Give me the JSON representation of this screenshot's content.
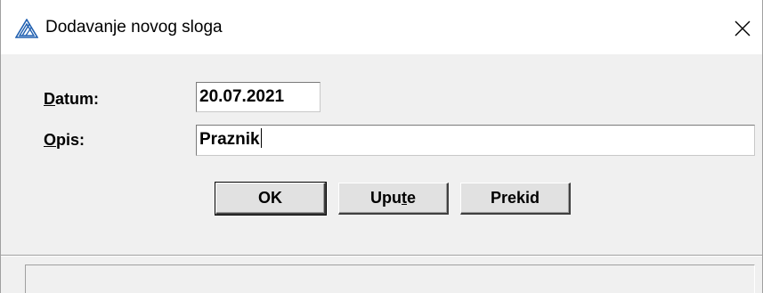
{
  "window": {
    "title": "Dodavanje novog sloga"
  },
  "form": {
    "datum_label_accel": "D",
    "datum_label_rest": "atum:",
    "datum_value": "20.07.2021",
    "opis_label_accel": "O",
    "opis_label_rest": "pis:",
    "opis_value": "Praznik"
  },
  "buttons": {
    "ok_label": "OK",
    "upute_label_pre": "Upu",
    "upute_label_accel": "t",
    "upute_label_post": "e",
    "prekid_label": "Prekid"
  },
  "status": {
    "text": ""
  },
  "colors": {
    "window_bg": "#f0f0f0",
    "titlebar_bg": "#ffffff",
    "icon_blue": "#1f5fb0"
  },
  "icons": {
    "app": "triangle-logo-icon",
    "close": "close-icon"
  }
}
